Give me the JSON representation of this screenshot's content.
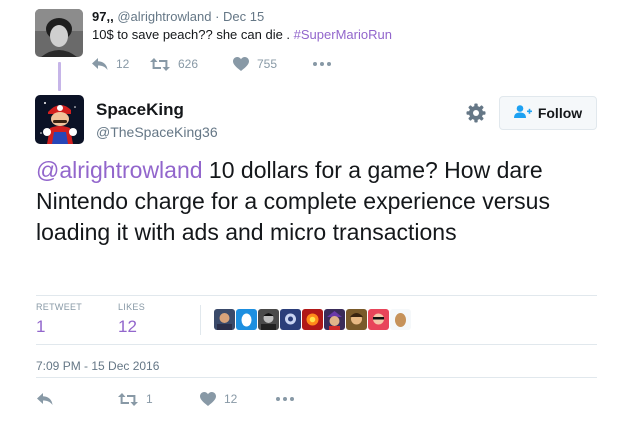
{
  "parent_tweet": {
    "name": "97,,",
    "handle": "@alrightrowland",
    "separator": "·",
    "date": "Dec 15",
    "text": "10$ to save peach?? she can die . ",
    "hashtag": "#SuperMarioRun",
    "replies": "12",
    "retweets": "626",
    "likes": "755"
  },
  "tweet": {
    "name": "SpaceKing",
    "handle": "@TheSpaceKing36",
    "follow_label": "Follow",
    "mention": "@alrightrowland",
    "text": " 10 dollars for a game? How dare Nintendo charge for a complete experience versus loading it with ads and micro transactions",
    "retweets_label": "RETWEET",
    "retweets_count": "1",
    "likes_label": "LIKES",
    "likes_count": "12",
    "timestamp": "7:09 PM - 15 Dec 2016",
    "bottom_retweets": "1",
    "bottom_likes": "12"
  },
  "colors": {
    "accent": "#9266cc",
    "muted": "#8899a6",
    "text": "#14171a",
    "thread_line": "#c6b5e8"
  },
  "icons": {
    "reply": "reply-icon",
    "retweet": "retweet-icon",
    "like": "heart-icon",
    "more": "more-icon",
    "settings": "gear-icon",
    "follow": "add-user-icon"
  }
}
